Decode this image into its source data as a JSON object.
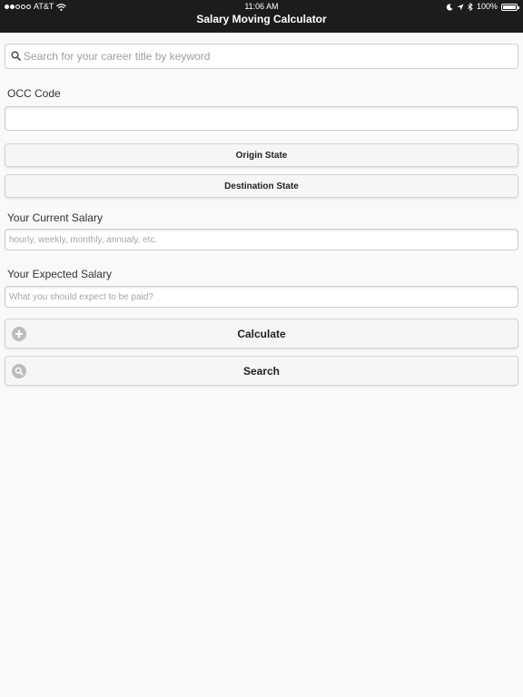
{
  "status_bar": {
    "carrier": "AT&T",
    "time": "11:06 AM",
    "battery": "100%"
  },
  "header": {
    "title": "Salary Moving Calculator"
  },
  "search": {
    "placeholder": "Search for your career title by keyword"
  },
  "occ_code": {
    "label": "OCC Code",
    "value": ""
  },
  "origin_state": {
    "label": "Origin State"
  },
  "destination_state": {
    "label": "Destination State"
  },
  "current_salary": {
    "label": "Your Current Salary",
    "placeholder": "hourly, weekly, monthly, annualy, etc.",
    "value": ""
  },
  "expected_salary": {
    "label": "Your Expected Salary",
    "placeholder": "What you should expect to be paid?",
    "value": ""
  },
  "actions": {
    "calculate_label": "Calculate",
    "calculate_icon": "plus-circle-icon",
    "search_label": "Search",
    "search_icon": "search-circle-icon"
  }
}
